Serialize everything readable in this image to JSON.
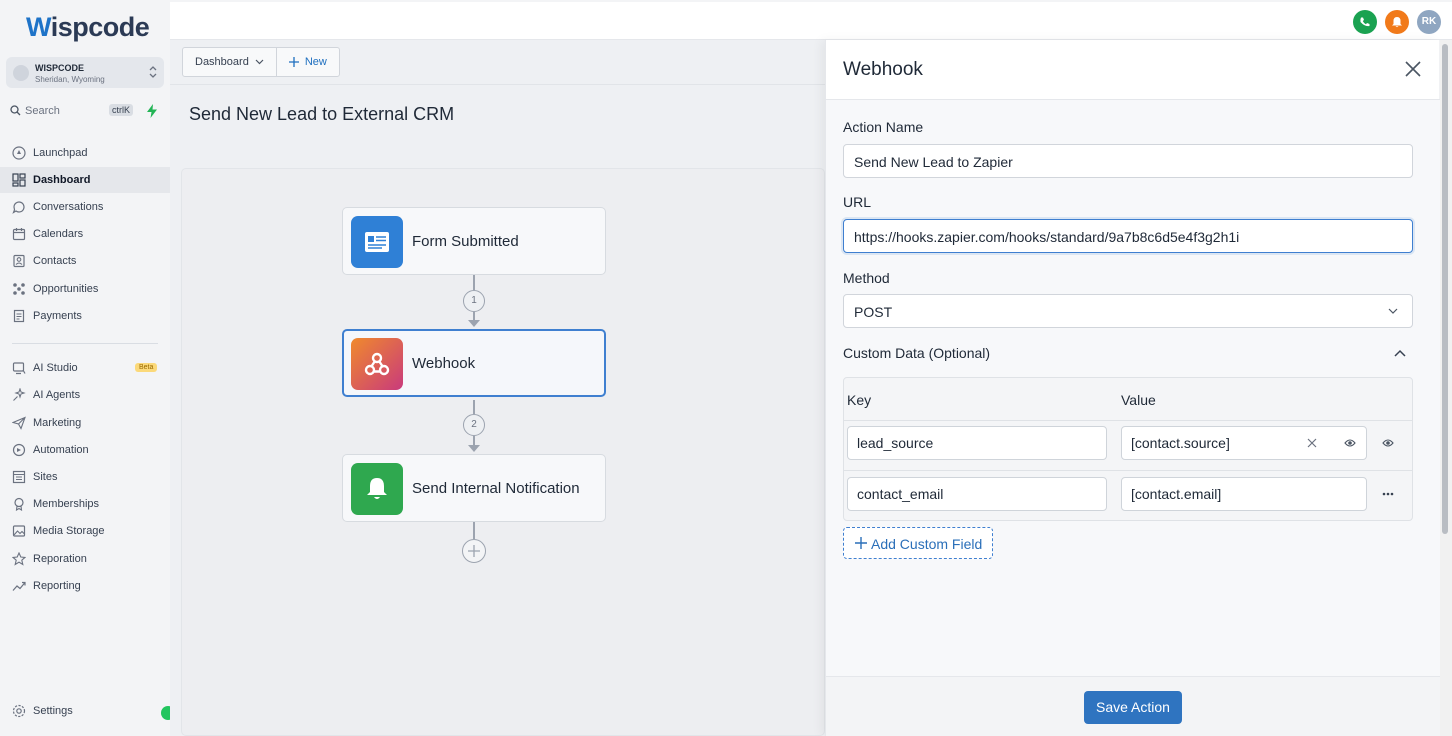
{
  "brand": {
    "logo_w": "W",
    "logo_rest": "ispcode"
  },
  "account": {
    "name": "WISPCODE",
    "location": "Sheridan, Wyoming"
  },
  "search": {
    "placeholder": "Search",
    "shortcut": "ctrlK"
  },
  "sidebar": {
    "items": [
      {
        "label": "Launchpad",
        "icon": "rocket-icon",
        "active": false
      },
      {
        "label": "Dashboard",
        "icon": "dashboard-icon",
        "active": true
      },
      {
        "label": "Conversations",
        "icon": "chat-icon",
        "active": false
      },
      {
        "label": "Calendars",
        "icon": "calendar-icon",
        "active": false
      },
      {
        "label": "Contacts",
        "icon": "contacts-icon",
        "active": false
      },
      {
        "label": "Opportunities",
        "icon": "opportunities-icon",
        "active": false
      },
      {
        "label": "Payments",
        "icon": "payments-icon",
        "active": false
      }
    ],
    "items2": [
      {
        "label": "AI Studio",
        "icon": "ai-studio-icon",
        "badge": "Beta"
      },
      {
        "label": "AI Agents",
        "icon": "ai-agents-icon"
      },
      {
        "label": "Marketing",
        "icon": "marketing-icon"
      },
      {
        "label": "Automation",
        "icon": "automation-icon"
      },
      {
        "label": "Sites",
        "icon": "sites-icon"
      },
      {
        "label": "Memberships",
        "icon": "memberships-icon"
      },
      {
        "label": "Media Storage",
        "icon": "media-storage-icon"
      },
      {
        "label": "Reporation",
        "icon": "star-icon"
      },
      {
        "label": "Reporting",
        "icon": "reporting-icon"
      }
    ],
    "settings_label": "Settings"
  },
  "topbar": {
    "avatar_initials": "RK",
    "phone_color": "#1aa251",
    "bell_color": "#f17a1a",
    "avatar_color": "#8fa6c1"
  },
  "toolbar": {
    "dashboard_tab": "Dashboard",
    "new_tab": "New"
  },
  "workflow": {
    "title": "Send New Lead to External CRM",
    "nodes": [
      {
        "label": "Form Submitted",
        "icon": "form-icon",
        "color": "#2f80d6"
      },
      {
        "label": "Webhook",
        "icon": "webhook-icon",
        "color": "#e2553d"
      },
      {
        "label": "Send Internal Notification",
        "icon": "bell-icon",
        "color": "#2fa84f"
      }
    ],
    "steps": [
      "1",
      "2"
    ]
  },
  "panel": {
    "title": "Webhook",
    "action_name_label": "Action Name",
    "action_name_value": "Send New Lead to Zapier",
    "url_label": "URL",
    "url_value": "https://hooks.zapier.com/hooks/standard/9a7b8c6d5e4f3g2h1i",
    "method_label": "Method",
    "method_value": "POST",
    "custom_data_label": "Custom Data (Optional)",
    "key_header": "Key",
    "value_header": "Value",
    "rows": [
      {
        "key": "lead_source",
        "value": "[contact.source]"
      },
      {
        "key": "contact_email",
        "value": "[contact.email]"
      }
    ],
    "add_field_label": "Add Custom Field",
    "save_label": "Save Action"
  }
}
